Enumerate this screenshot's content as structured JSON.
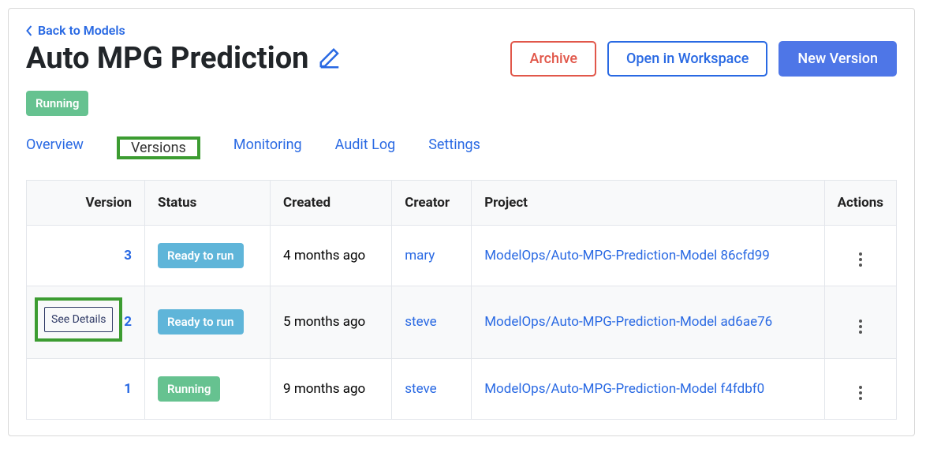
{
  "back_link": "Back to Models",
  "title": "Auto MPG Prediction",
  "header_buttons": {
    "archive": "Archive",
    "open": "Open in Workspace",
    "new_version": "New Version"
  },
  "status": {
    "running": "Running",
    "ready": "Ready to run"
  },
  "tabs": {
    "overview": "Overview",
    "versions": "Versions",
    "monitoring": "Monitoring",
    "audit_log": "Audit Log",
    "settings": "Settings"
  },
  "see_details": "See Details",
  "table": {
    "headers": {
      "version": "Version",
      "status": "Status",
      "created": "Created",
      "creator": "Creator",
      "project": "Project",
      "actions": "Actions"
    },
    "rows": [
      {
        "version": "3",
        "status": "ready",
        "created": "4 months ago",
        "creator": "mary",
        "project": "ModelOps/Auto-MPG-Prediction-Model 86cfd99"
      },
      {
        "version": "2",
        "status": "ready",
        "created": "5 months ago",
        "creator": "steve",
        "project": "ModelOps/Auto-MPG-Prediction-Model ad6ae76"
      },
      {
        "version": "1",
        "status": "running",
        "created": "9 months ago",
        "creator": "steve",
        "project": "ModelOps/Auto-MPG-Prediction-Model f4fdbf0"
      }
    ]
  }
}
